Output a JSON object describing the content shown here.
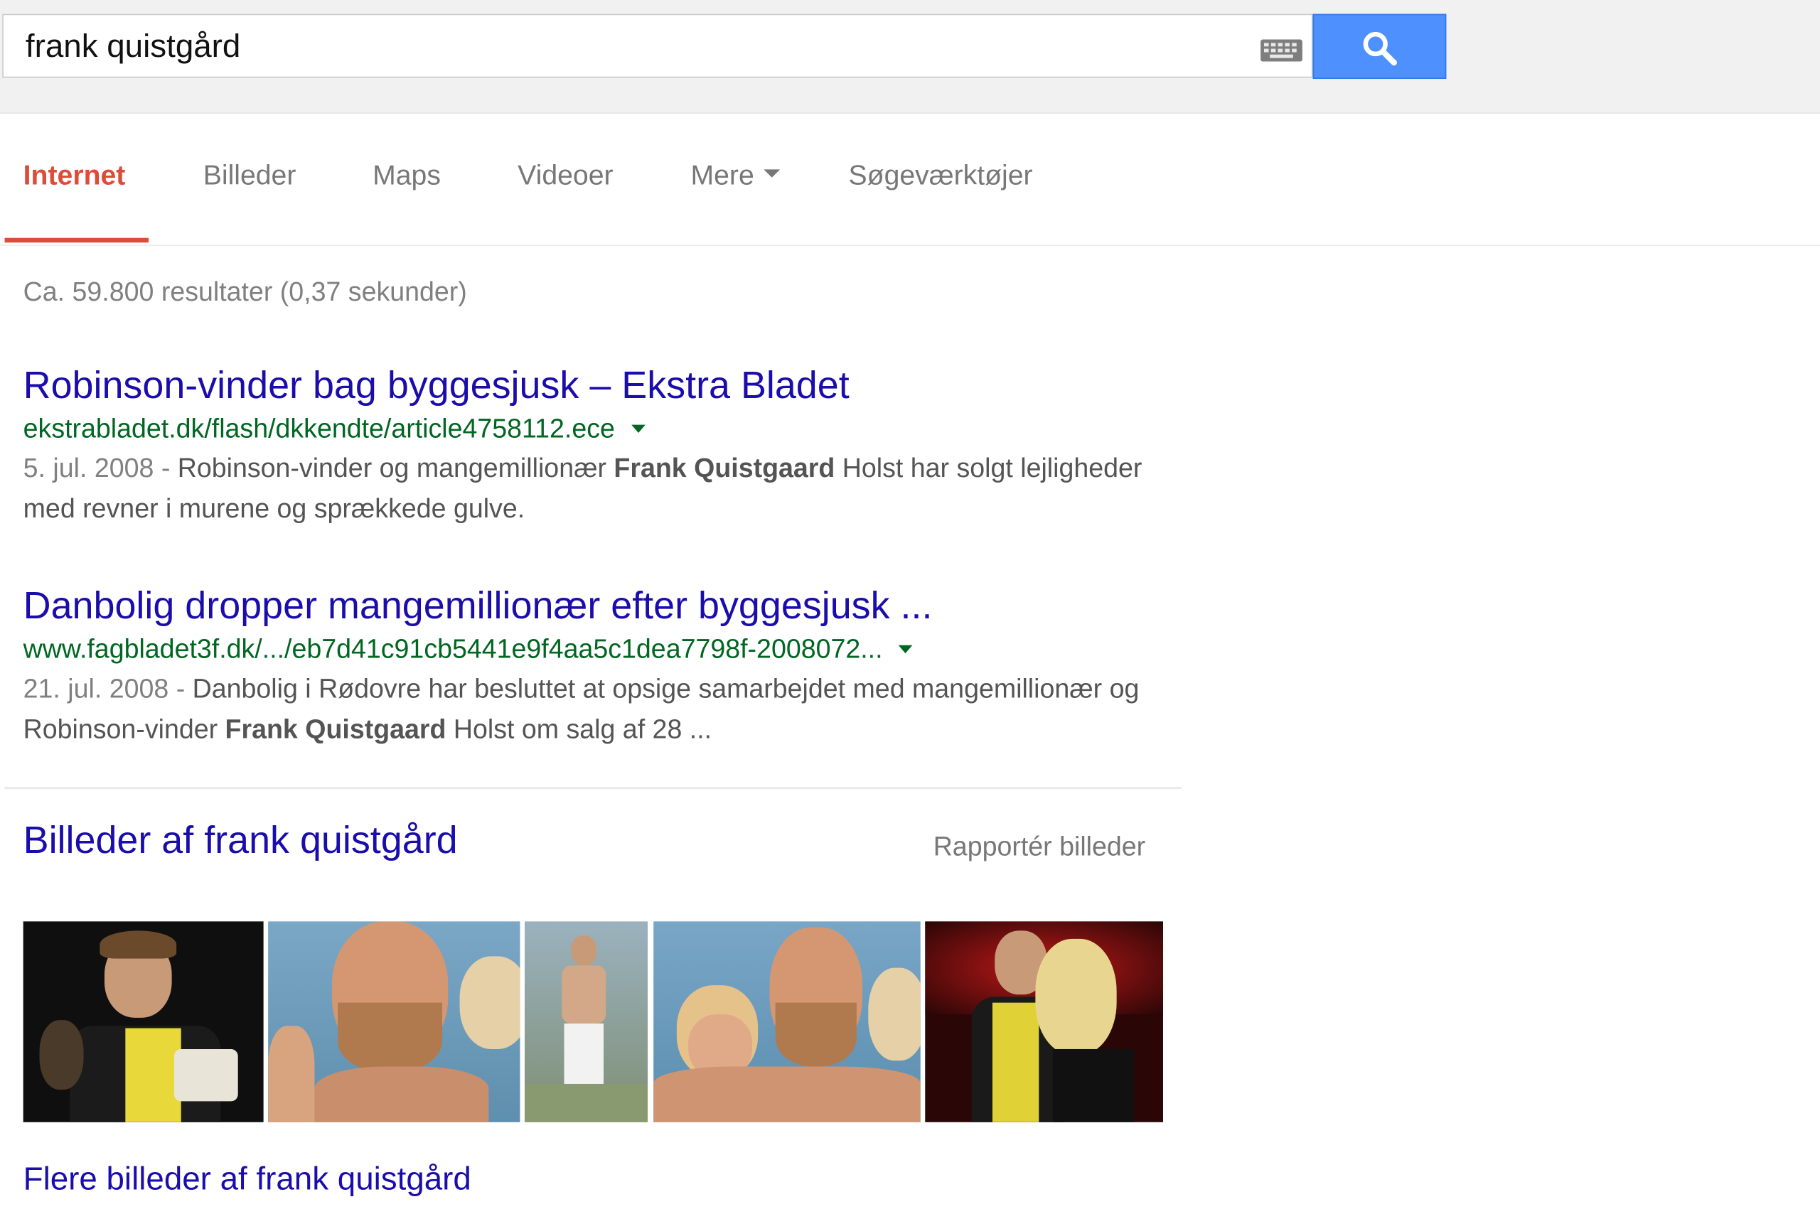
{
  "search": {
    "query": "frank quistgård"
  },
  "icons": {
    "keyboard": "keyboard-icon",
    "search": "magnifier-icon"
  },
  "tabs": [
    {
      "label": "Internet",
      "active": true
    },
    {
      "label": "Billeder"
    },
    {
      "label": "Maps"
    },
    {
      "label": "Videoer"
    },
    {
      "label": "Mere"
    },
    {
      "label": "Søgeværktøjer"
    }
  ],
  "stats": "Ca. 59.800 resultater (0,37 sekunder)",
  "results": [
    {
      "title": "Robinson-vinder bag byggesjusk – Ekstra Bladet",
      "url": "ekstrabladet.dk/flash/dkkendte/article4758112.ece",
      "date": "5. jul. 2008 - ",
      "snippet_a": "Robinson-vinder og mangemillionær ",
      "snippet_bold": "Frank Quistgaard",
      "snippet_b": " Holst har solgt lejligheder med revner i murene og sprækkede gulve."
    },
    {
      "title": "Danbolig dropper mangemillionær efter byggesjusk ...",
      "url": "www.fagbladet3f.dk/.../eb7d41c91cb5441e9f4aa5c1dea7798f-2008072...",
      "date": "21. jul. 2008 - ",
      "snippet_a": "Danbolig i Rødovre har besluttet at opsige samarbejdet med mangemillionær og Robinson-vinder ",
      "snippet_bold": "Frank Quistgaard",
      "snippet_b": " Holst om salg af 28 ..."
    }
  ],
  "images": {
    "heading": "Billeder af frank quistgård",
    "report": "Rapportér billeder",
    "more": "Flere billeder af frank quistgård"
  },
  "colors": {
    "accent": "#dd4b39",
    "link": "#1a0dab",
    "url": "#006621",
    "search_button": "#4d90fe"
  }
}
